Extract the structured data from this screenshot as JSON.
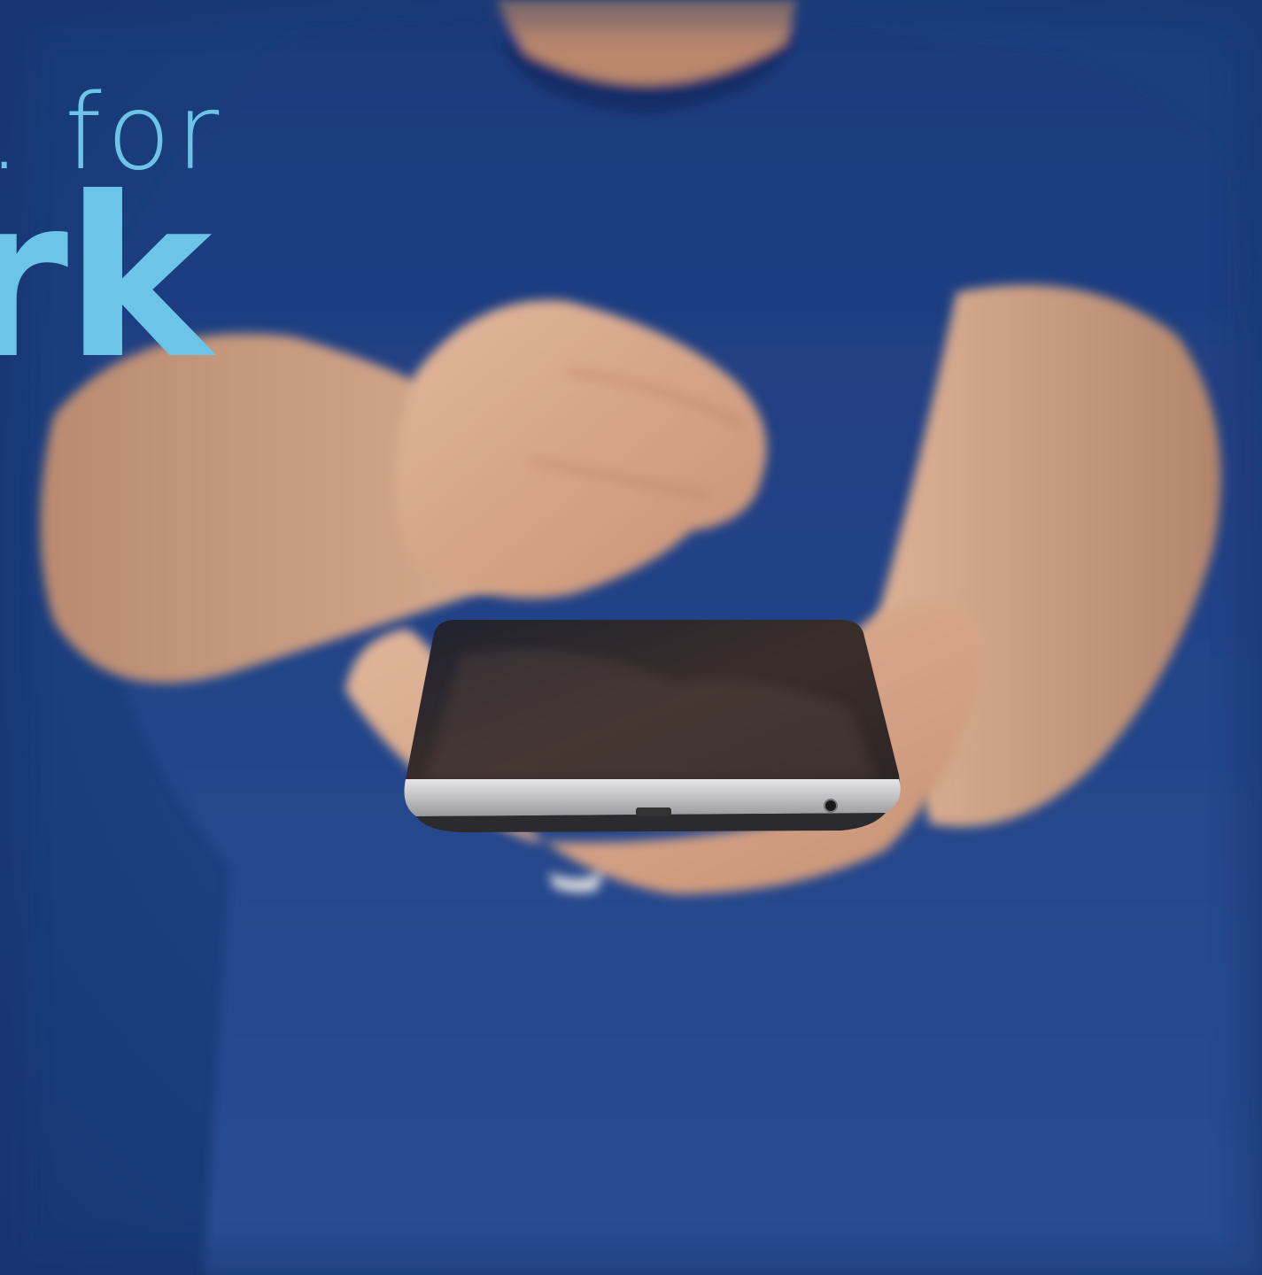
{
  "headline": {
    "line1": ". for",
    "line2": "rk"
  },
  "colors": {
    "background": "#1d4284",
    "shirt": "#1f3f86",
    "headline_text": "#6cc4e8",
    "skin": "#d9a98c",
    "device_screen": "#2a2728",
    "device_frame": "#c9c9cb"
  },
  "icons": {
    "port": "micro-usb-port",
    "jack": "headphone-jack"
  }
}
